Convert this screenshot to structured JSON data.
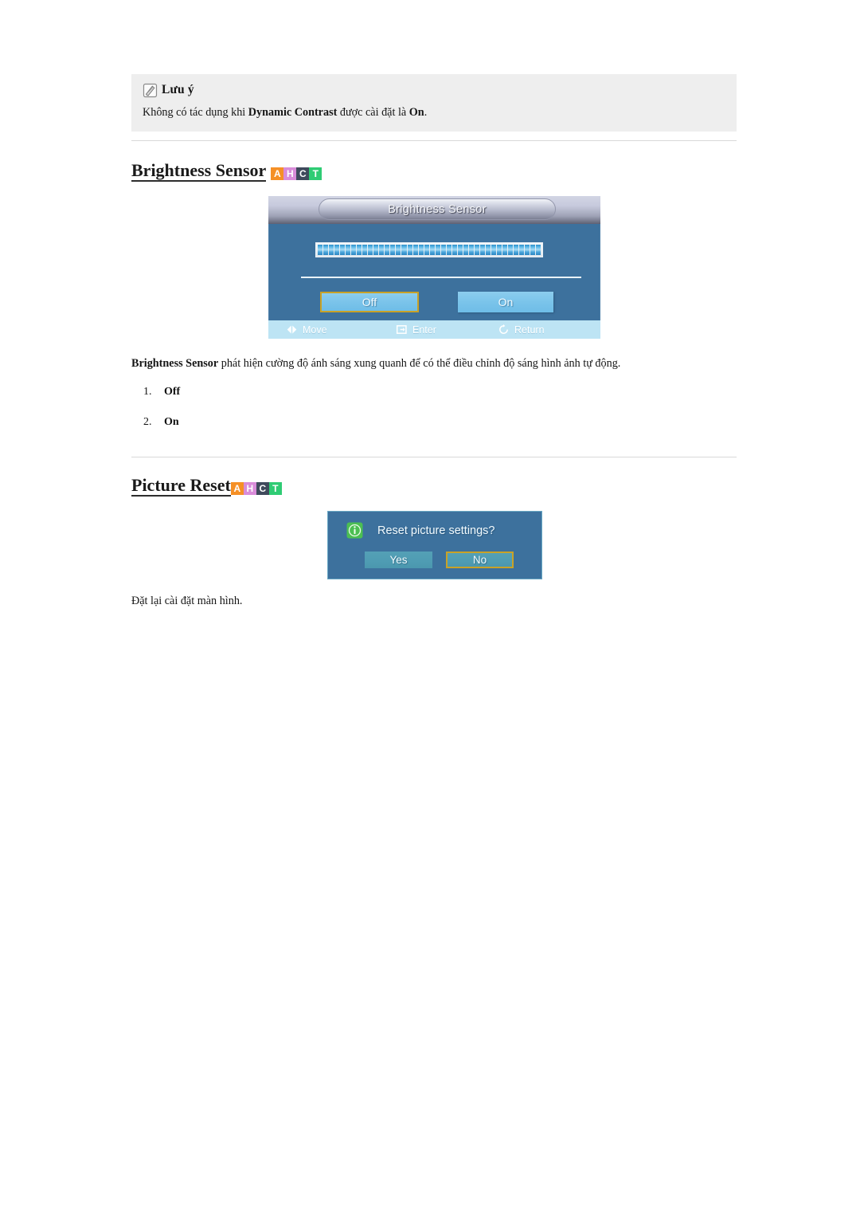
{
  "note": {
    "icon": "note-pencil-icon",
    "title": "Lưu ý",
    "text_before": "Không có tác dụng khi ",
    "text_bold1": "Dynamic Contrast",
    "text_middle": " được cài đặt là ",
    "text_bold2": "On",
    "text_after": "."
  },
  "badges": [
    {
      "letter": "A",
      "color": "#f59026"
    },
    {
      "letter": "H",
      "color": "#d98cd9"
    },
    {
      "letter": "C",
      "color": "#3f4a5c"
    },
    {
      "letter": "T",
      "color": "#2fcc74"
    }
  ],
  "sections": {
    "brightness": {
      "heading": "Brightness Sensor",
      "osd": {
        "title": "Brightness Sensor",
        "level_segments": 40,
        "level_fill_percent": 100,
        "buttons": [
          {
            "label": "Off",
            "selected": true
          },
          {
            "label": "On",
            "selected": false
          }
        ],
        "footer": [
          {
            "icon": "move-arrows-icon",
            "label": "Move"
          },
          {
            "icon": "enter-icon",
            "label": "Enter"
          },
          {
            "icon": "return-icon",
            "label": "Return"
          }
        ]
      },
      "description_bold": "Brightness Sensor",
      "description_rest": " phát hiện cường độ ánh sáng xung quanh để có thể điều chỉnh độ sáng hình ảnh tự động.",
      "list": [
        {
          "num": "1.",
          "value": "Off"
        },
        {
          "num": "2.",
          "value": "On"
        }
      ]
    },
    "picture_reset": {
      "heading": "Picture Reset",
      "dialog": {
        "icon": "info-icon",
        "question": "Reset picture settings?",
        "buttons": [
          {
            "label": "Yes",
            "selected": false
          },
          {
            "label": "No",
            "selected": true
          }
        ]
      },
      "caption": "Đặt lại cài đặt màn hình."
    }
  }
}
